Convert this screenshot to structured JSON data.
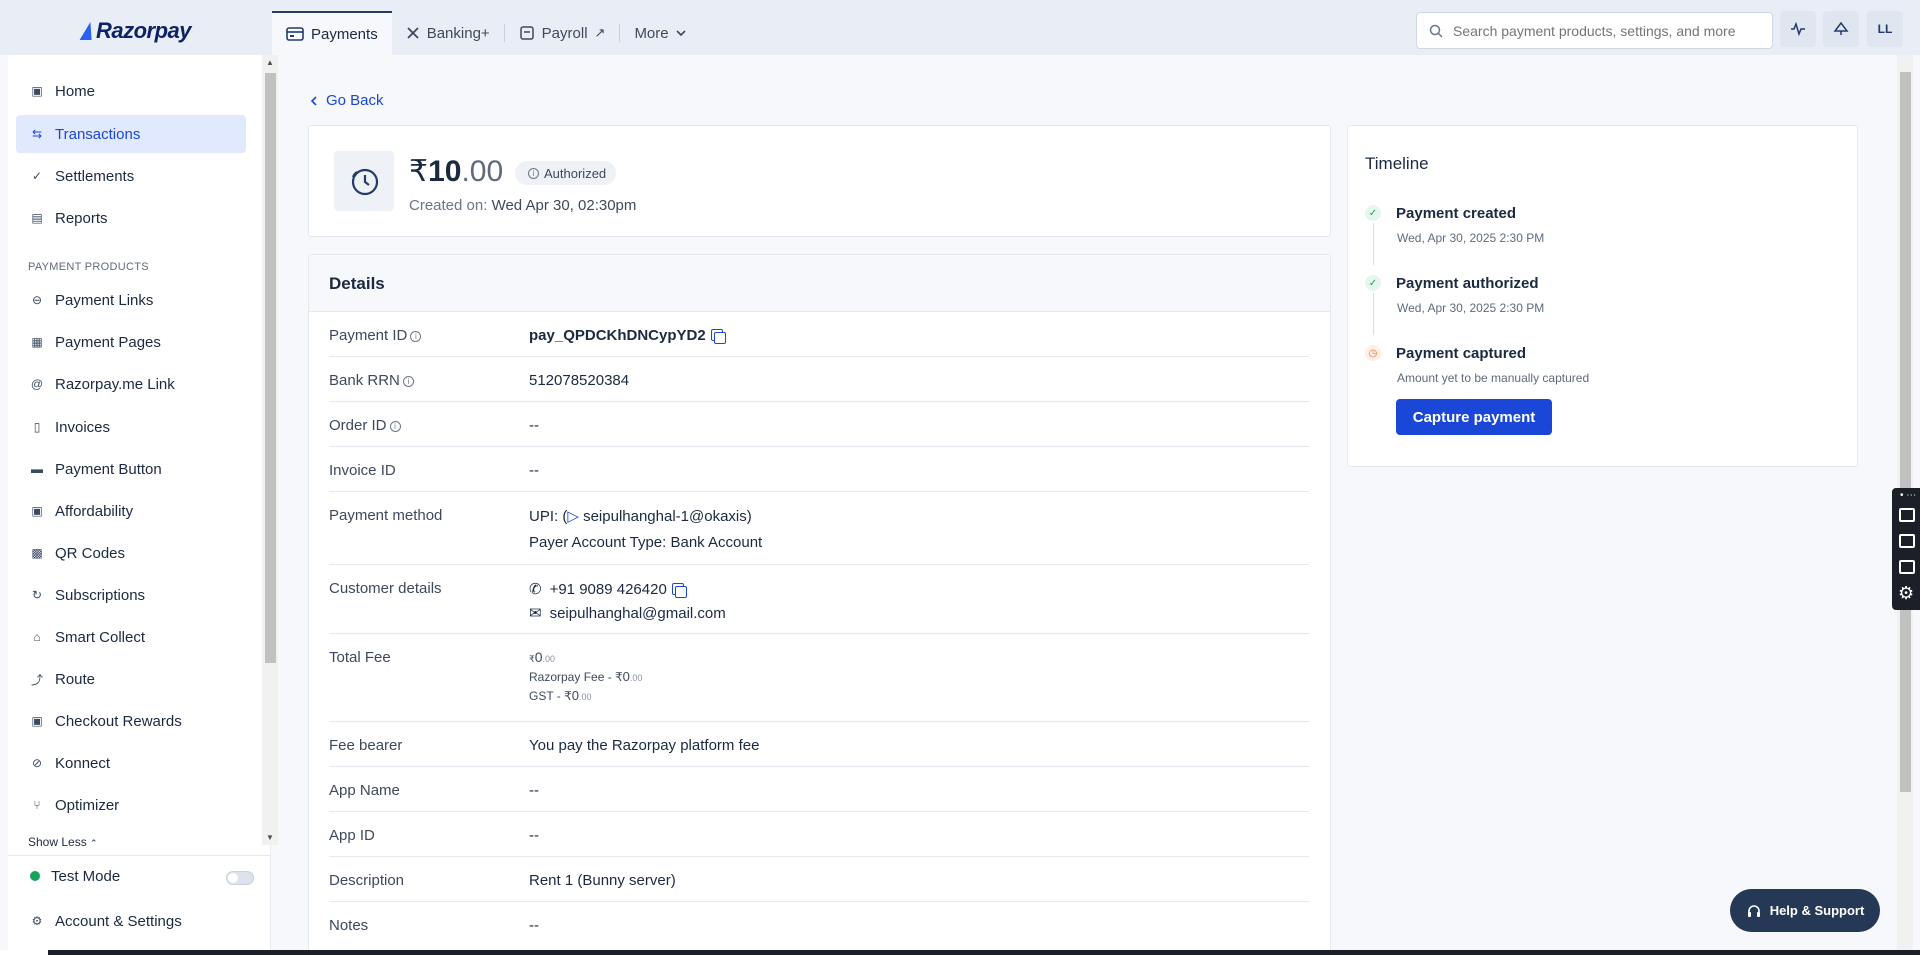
{
  "brand": {
    "name": "Razorpay"
  },
  "tabs": [
    {
      "label": "Payments",
      "icon": "payments-icon"
    },
    {
      "label": "Banking+",
      "icon": "banking-icon"
    },
    {
      "label": "Payroll",
      "icon": "payroll-icon"
    },
    {
      "label": "More",
      "icon": "chevron-down-icon"
    }
  ],
  "search": {
    "placeholder": "Search payment products, settings, and more"
  },
  "top_icons": {
    "avatar": "LL"
  },
  "sidebar": {
    "items": [
      {
        "label": "Home"
      },
      {
        "label": "Transactions"
      },
      {
        "label": "Settlements"
      },
      {
        "label": "Reports"
      }
    ],
    "section_label": "PAYMENT PRODUCTS",
    "products": [
      {
        "label": "Payment Links"
      },
      {
        "label": "Payment Pages"
      },
      {
        "label": "Razorpay.me Link"
      },
      {
        "label": "Invoices"
      },
      {
        "label": "Payment Button"
      },
      {
        "label": "Affordability"
      },
      {
        "label": "QR Codes"
      },
      {
        "label": "Subscriptions"
      },
      {
        "label": "Smart Collect"
      },
      {
        "label": "Route"
      },
      {
        "label": "Checkout Rewards"
      },
      {
        "label": "Konnect"
      },
      {
        "label": "Optimizer"
      }
    ],
    "show_less": "Show Less",
    "test_mode": "Test Mode",
    "account_settings": "Account & Settings"
  },
  "go_back": "Go Back",
  "summary": {
    "currency": "₹",
    "amount_int": "10",
    "amount_dec": ".00",
    "status": "Authorized",
    "created_label": "Created on:",
    "created_value": "Wed Apr 30, 02:30pm"
  },
  "details": {
    "title": "Details",
    "payment_id_label": "Payment ID",
    "payment_id": "pay_QPDCKhDNCypYD2",
    "bank_rrn_label": "Bank RRN",
    "bank_rrn": "512078520384",
    "order_id_label": "Order ID",
    "order_id": "--",
    "invoice_id_label": "Invoice ID",
    "invoice_id": "--",
    "payment_method_label": "Payment method",
    "upi_prefix": "UPI:",
    "upi_id": "seipulhanghal-1@okaxis)",
    "payer_account_type": "Payer Account Type:  Bank Account",
    "customer_label": "Customer details",
    "phone": "+91 9089 426420",
    "email": "seipulhanghal@gmail.com",
    "total_fee_label": "Total Fee",
    "total_fee_cur": "₹",
    "total_fee_int": "0",
    "total_fee_dec": ".00",
    "razorpay_fee": "Razorpay Fee - ₹",
    "razorpay_fee_int": "0",
    "razorpay_fee_dec": ".00",
    "gst": "GST - ₹",
    "gst_int": "0",
    "gst_dec": ".00",
    "fee_bearer_label": "Fee bearer",
    "fee_bearer": "You pay the Razorpay platform fee",
    "app_name_label": "App Name",
    "app_name": "--",
    "app_id_label": "App ID",
    "app_id": "--",
    "description_label": "Description",
    "description": "Rent 1 (Bunny server)",
    "notes_label": "Notes",
    "notes": "--"
  },
  "timeline": {
    "title": "Timeline",
    "steps": [
      {
        "title": "Payment created",
        "sub": "Wed, Apr 30, 2025 2:30 PM",
        "status": "done"
      },
      {
        "title": "Payment authorized",
        "sub": "Wed, Apr 30, 2025 2:30 PM",
        "status": "done"
      },
      {
        "title": "Payment captured",
        "sub": "Amount yet to be manually captured",
        "status": "pending"
      }
    ],
    "capture_button": "Capture payment"
  },
  "help": {
    "label": "Help & Support"
  },
  "colors": {
    "accent": "#1a47d8",
    "success": "#15a359",
    "pending": "#e8743b"
  }
}
